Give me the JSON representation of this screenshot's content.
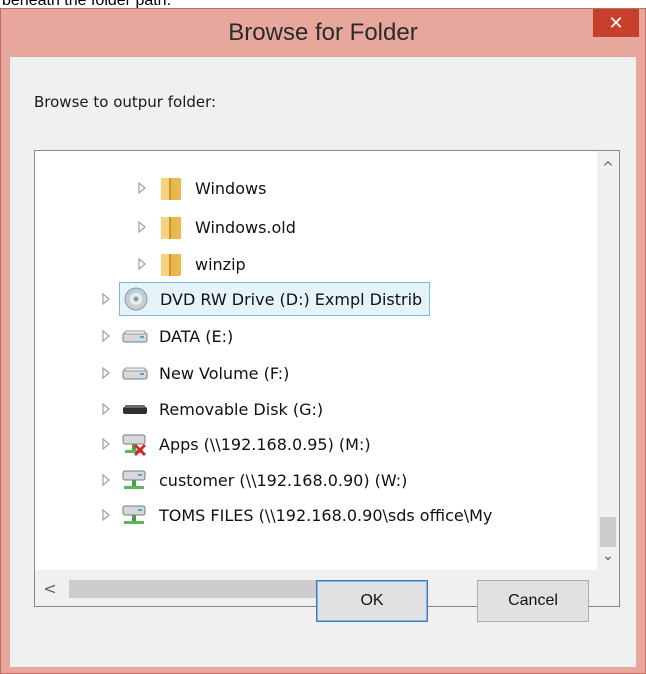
{
  "caption": "beneath the folder path.",
  "dialog": {
    "title": "Browse for Folder",
    "close_glyph": "✕",
    "prompt": "Browse to outpur folder:",
    "ok_label": "OK",
    "cancel_label": "Cancel"
  },
  "tree": {
    "items": [
      {
        "label": "Windows",
        "icon": "folder-icon",
        "level": 2
      },
      {
        "label": "Windows.old",
        "icon": "folder-icon",
        "level": 2
      },
      {
        "label": "winzip",
        "icon": "folder-icon",
        "level": 2
      },
      {
        "label": "DVD RW Drive (D:) Exmpl Distrib",
        "icon": "dvd-drive-icon",
        "level": 1,
        "selected": true
      },
      {
        "label": "DATA (E:)",
        "icon": "hard-drive-icon",
        "level": 1
      },
      {
        "label": "New Volume (F:)",
        "icon": "hard-drive-icon",
        "level": 1
      },
      {
        "label": "Removable Disk (G:)",
        "icon": "removable-disk-icon",
        "level": 1
      },
      {
        "label": "Apps (\\\\192.168.0.95) (M:)",
        "icon": "disconnected-network-drive-icon",
        "level": 1
      },
      {
        "label": "customer (\\\\192.168.0.90) (W:)",
        "icon": "network-drive-icon",
        "level": 1
      },
      {
        "label": "TOMS FILES (\\\\192.168.0.90\\sds office\\My",
        "icon": "network-drive-icon",
        "level": 1
      }
    ]
  },
  "scrollbars": {
    "up_glyph": "^",
    "down_glyph": "⌄",
    "left_glyph": "<",
    "right_glyph": ">"
  }
}
